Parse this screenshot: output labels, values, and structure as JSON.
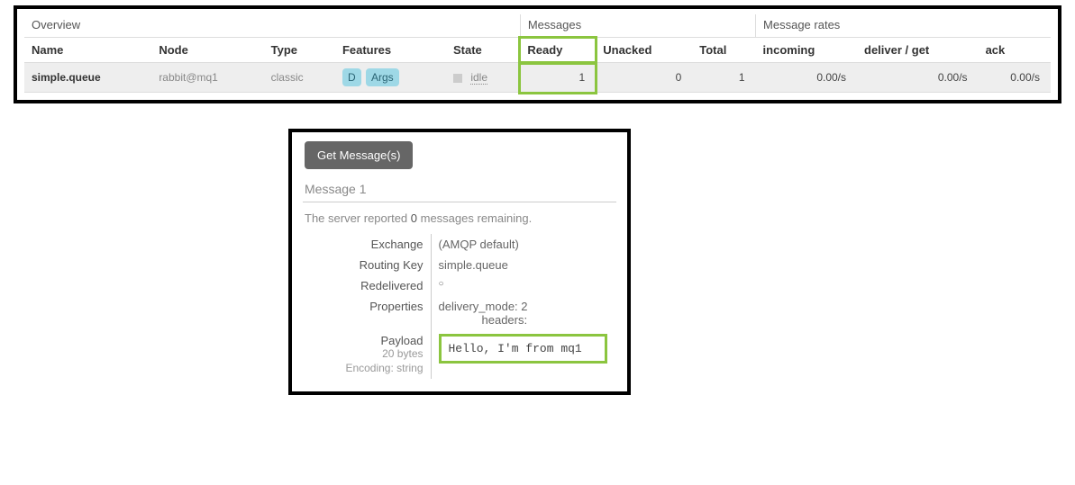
{
  "expand_toggle": "+/-",
  "groups": {
    "overview": "Overview",
    "messages": "Messages",
    "rates": "Message rates"
  },
  "headers": {
    "name": "Name",
    "node": "Node",
    "type": "Type",
    "features": "Features",
    "state": "State",
    "ready": "Ready",
    "unacked": "Unacked",
    "total": "Total",
    "incoming": "incoming",
    "deliver_get": "deliver / get",
    "ack": "ack"
  },
  "row": {
    "name": "simple.queue",
    "node": "rabbit@mq1",
    "type": "classic",
    "feature_d": "D",
    "feature_args": "Args",
    "state": "idle",
    "ready": "1",
    "unacked": "0",
    "total": "1",
    "incoming": "0.00/s",
    "deliver_get": "0.00/s",
    "ack": "0.00/s"
  },
  "panel": {
    "get_btn": "Get Message(s)",
    "msg_title": "Message 1",
    "remaining_pre": "The server reported ",
    "remaining_count": "0",
    "remaining_post": " messages remaining.",
    "labels": {
      "exchange": "Exchange",
      "routing_key": "Routing Key",
      "redelivered": "Redelivered",
      "properties": "Properties",
      "payload": "Payload"
    },
    "values": {
      "exchange": "(AMQP default)",
      "routing_key": "simple.queue",
      "redelivered": "○",
      "prop_delivery_mode_k": "delivery_mode:",
      "prop_delivery_mode_v": "2",
      "prop_headers": "headers:",
      "payload_size": "20 bytes",
      "payload_encoding": "Encoding: string",
      "payload": "Hello, I'm from mq1"
    }
  }
}
